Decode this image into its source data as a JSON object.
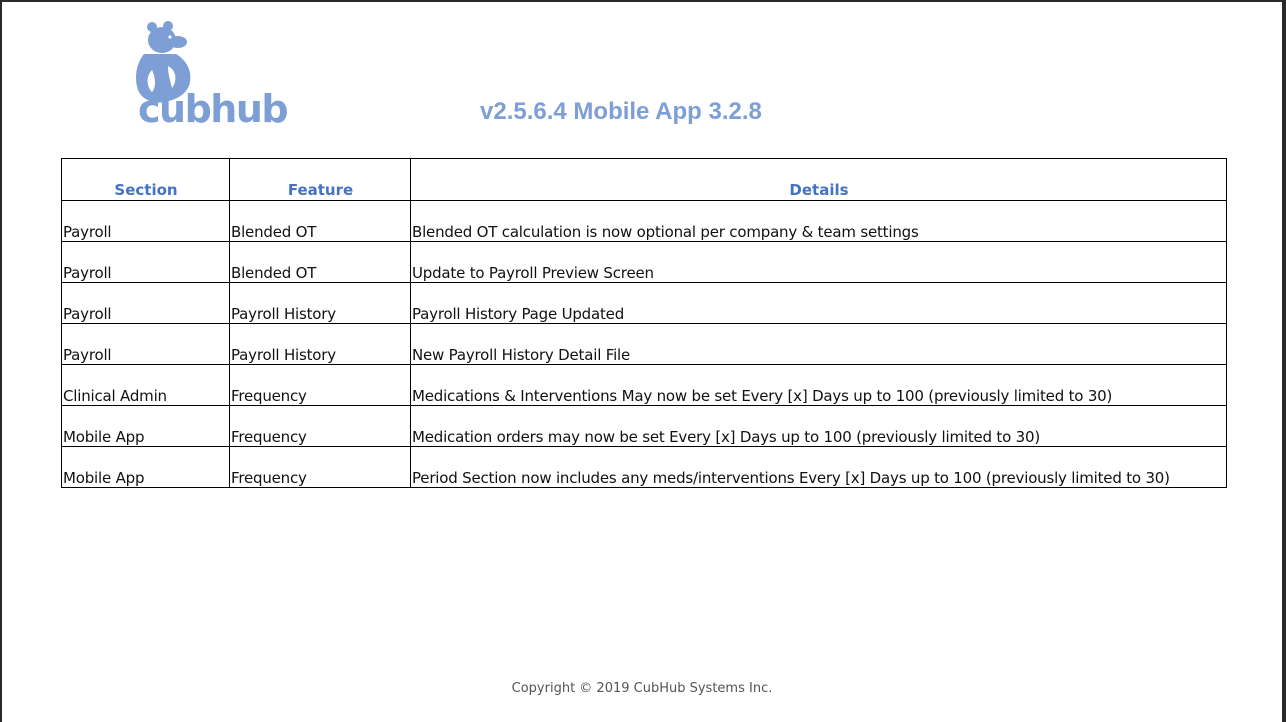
{
  "logo": {
    "text": "cubhub",
    "icon": "bear-icon",
    "color": "#7e9ed6"
  },
  "title": "v2.5.6.4 Mobile App 3.2.8",
  "table": {
    "headers": [
      "Section",
      "Feature",
      "Details"
    ],
    "header_color": "#4472c4",
    "rows": [
      [
        "Payroll",
        "Blended OT",
        "Blended OT calculation is now optional per company & team settings"
      ],
      [
        "Payroll",
        "Blended OT",
        "Update to Payroll Preview Screen"
      ],
      [
        "Payroll",
        "Payroll History",
        "Payroll History Page Updated"
      ],
      [
        "Payroll",
        "Payroll History",
        "New Payroll History Detail File"
      ],
      [
        "Clinical Admin",
        "Frequency",
        "Medications & Interventions May now be set Every [x] Days up to 100 (previously limited to 30)"
      ],
      [
        "Mobile App",
        "Frequency",
        "Medication orders may now be set Every [x] Days up to 100 (previously limited to 30)"
      ],
      [
        "Mobile App",
        "Frequency",
        "Period Section now includes any meds/interventions Every [x] Days up to 100 (previously limited to 30)"
      ]
    ]
  },
  "footer": {
    "copyright": "Copyright © 2019 CubHub Systems Inc."
  }
}
